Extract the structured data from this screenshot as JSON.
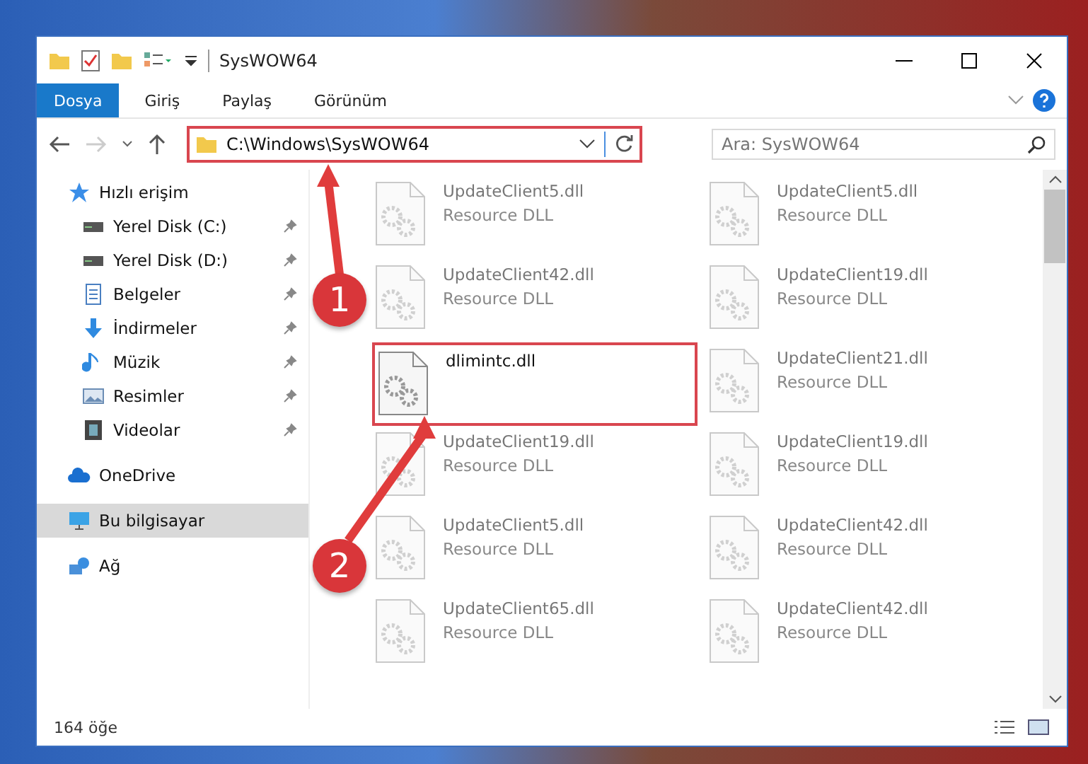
{
  "window": {
    "title": "SysWOW64"
  },
  "ribbon_tabs": [
    {
      "label": "Dosya",
      "selected": true
    },
    {
      "label": "Giriş",
      "selected": false
    },
    {
      "label": "Paylaş",
      "selected": false
    },
    {
      "label": "Görünüm",
      "selected": false
    }
  ],
  "address_bar": {
    "path": "C:\\Windows\\SysWOW64",
    "highlighted": true
  },
  "search": {
    "placeholder": "Ara: SysWOW64"
  },
  "sidebar": {
    "items": [
      {
        "label": "Hızlı erişim",
        "kind": "quick",
        "pinned": false,
        "selected": false,
        "children": [
          {
            "label": "Yerel Disk (C:)",
            "kind": "disk",
            "pinned": true,
            "selected": false
          },
          {
            "label": "Yerel Disk (D:)",
            "kind": "disk",
            "pinned": true,
            "selected": false
          },
          {
            "label": "Belgeler",
            "kind": "docs",
            "pinned": true,
            "selected": false
          },
          {
            "label": "İndirmeler",
            "kind": "downloads",
            "pinned": true,
            "selected": false
          },
          {
            "label": "Müzik",
            "kind": "music",
            "pinned": true,
            "selected": false
          },
          {
            "label": "Resimler",
            "kind": "pictures",
            "pinned": true,
            "selected": false
          },
          {
            "label": "Videolar",
            "kind": "videos",
            "pinned": true,
            "selected": false
          }
        ]
      },
      {
        "label": "OneDrive",
        "kind": "cloud",
        "pinned": false,
        "selected": false
      },
      {
        "label": "Bu bilgisayar",
        "kind": "pc",
        "pinned": false,
        "selected": true
      },
      {
        "label": "Ağ",
        "kind": "network",
        "pinned": false,
        "selected": false
      }
    ]
  },
  "files": [
    {
      "name": "UpdateClient5.dll",
      "type": "Resource DLL",
      "blurred": true,
      "highlighted": false
    },
    {
      "name": "UpdateClient5.dll",
      "type": "Resource DLL",
      "blurred": true,
      "highlighted": false
    },
    {
      "name": "UpdateClient42.dll",
      "type": "Resource DLL",
      "blurred": true,
      "highlighted": false
    },
    {
      "name": "UpdateClient19.dll",
      "type": "Resource DLL",
      "blurred": true,
      "highlighted": false
    },
    {
      "name": "dlimintc.dll",
      "blurred": false,
      "highlighted": true
    },
    {
      "name": "UpdateClient21.dll",
      "type": "Resource DLL",
      "blurred": true,
      "highlighted": false
    },
    {
      "name": "UpdateClient19.dll",
      "type": "Resource DLL",
      "blurred": true,
      "highlighted": false
    },
    {
      "name": "UpdateClient19.dll",
      "type": "Resource DLL",
      "blurred": true,
      "highlighted": false
    },
    {
      "name": "UpdateClient5.dll",
      "type": "Resource DLL",
      "blurred": true,
      "highlighted": false
    },
    {
      "name": "UpdateClient42.dll",
      "type": "Resource DLL",
      "blurred": true,
      "highlighted": false
    },
    {
      "name": "UpdateClient65.dll",
      "type": "Resource DLL",
      "blurred": true,
      "highlighted": false
    },
    {
      "name": "UpdateClient42.dll",
      "type": "Resource DLL",
      "blurred": true,
      "highlighted": false
    }
  ],
  "status_bar": {
    "count": "164 öğe"
  },
  "annotations": [
    {
      "label": "1"
    },
    {
      "label": "2"
    }
  ]
}
